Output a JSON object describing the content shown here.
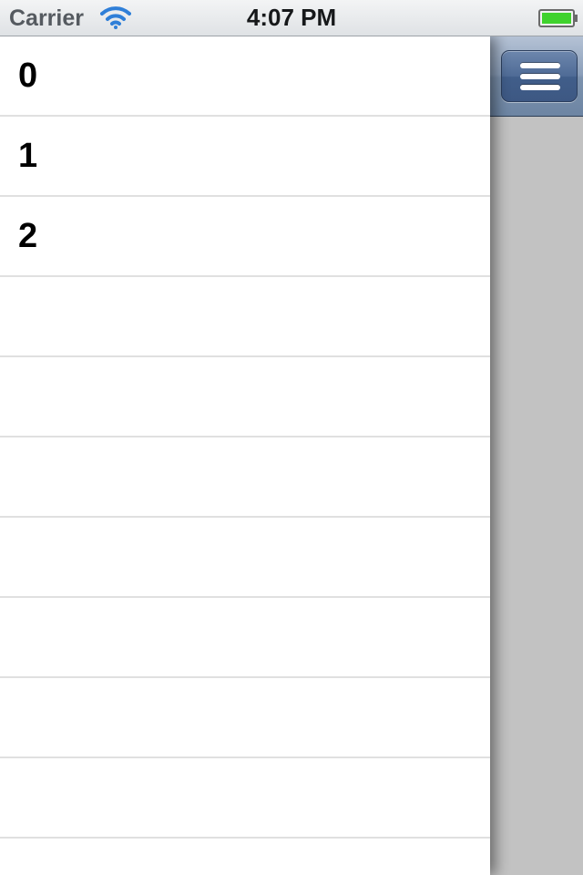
{
  "status_bar": {
    "carrier": "Carrier",
    "time": "4:07 PM",
    "wifi_icon": "wifi-icon",
    "battery_icon": "battery-icon",
    "battery_color": "#3fd22d"
  },
  "side_menu": {
    "button_icon": "hamburger-menu-icon",
    "button_color": "#4f6b96",
    "background_color": "#c2c2c2"
  },
  "table": {
    "rows": [
      {
        "label": "0"
      },
      {
        "label": "1"
      },
      {
        "label": "2"
      },
      {
        "label": ""
      },
      {
        "label": ""
      },
      {
        "label": ""
      },
      {
        "label": ""
      },
      {
        "label": ""
      },
      {
        "label": ""
      },
      {
        "label": ""
      },
      {
        "label": ""
      }
    ],
    "separator_color": "#e0e0e0"
  }
}
